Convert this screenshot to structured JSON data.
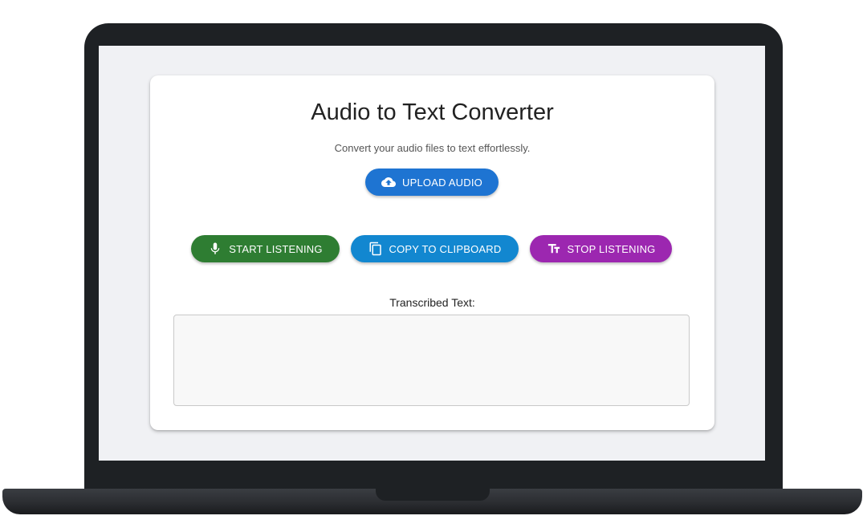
{
  "app": {
    "title": "Audio to Text Converter",
    "subtitle": "Convert your audio files to text effortlessly."
  },
  "buttons": {
    "upload": {
      "label": "UPLOAD AUDIO",
      "icon": "cloud-upload-icon",
      "color": "#1e74d2"
    },
    "start": {
      "label": "START LISTENING",
      "icon": "microphone-icon",
      "color": "#2e7d32"
    },
    "copy": {
      "label": "COPY TO CLIPBOARD",
      "icon": "copy-icon",
      "color": "#1287d0"
    },
    "stop": {
      "label": "STOP LISTENING",
      "icon": "text-fields-icon",
      "color": "#9c27b0"
    }
  },
  "transcript": {
    "label": "Transcribed Text:",
    "value": ""
  }
}
